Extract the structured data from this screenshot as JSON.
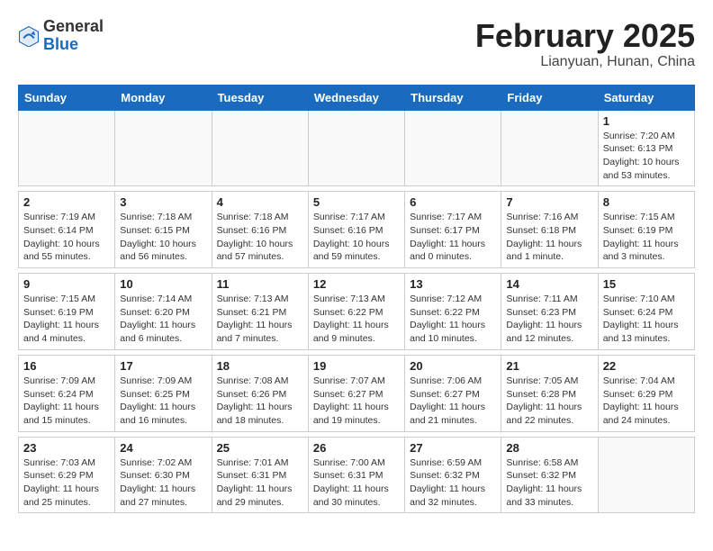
{
  "header": {
    "logo_general": "General",
    "logo_blue": "Blue",
    "month_title": "February 2025",
    "location": "Lianyuan, Hunan, China"
  },
  "days_of_week": [
    "Sunday",
    "Monday",
    "Tuesday",
    "Wednesday",
    "Thursday",
    "Friday",
    "Saturday"
  ],
  "weeks": [
    [
      {
        "day": "",
        "info": ""
      },
      {
        "day": "",
        "info": ""
      },
      {
        "day": "",
        "info": ""
      },
      {
        "day": "",
        "info": ""
      },
      {
        "day": "",
        "info": ""
      },
      {
        "day": "",
        "info": ""
      },
      {
        "day": "1",
        "info": "Sunrise: 7:20 AM\nSunset: 6:13 PM\nDaylight: 10 hours\nand 53 minutes."
      }
    ],
    [
      {
        "day": "2",
        "info": "Sunrise: 7:19 AM\nSunset: 6:14 PM\nDaylight: 10 hours\nand 55 minutes."
      },
      {
        "day": "3",
        "info": "Sunrise: 7:18 AM\nSunset: 6:15 PM\nDaylight: 10 hours\nand 56 minutes."
      },
      {
        "day": "4",
        "info": "Sunrise: 7:18 AM\nSunset: 6:16 PM\nDaylight: 10 hours\nand 57 minutes."
      },
      {
        "day": "5",
        "info": "Sunrise: 7:17 AM\nSunset: 6:16 PM\nDaylight: 10 hours\nand 59 minutes."
      },
      {
        "day": "6",
        "info": "Sunrise: 7:17 AM\nSunset: 6:17 PM\nDaylight: 11 hours\nand 0 minutes."
      },
      {
        "day": "7",
        "info": "Sunrise: 7:16 AM\nSunset: 6:18 PM\nDaylight: 11 hours\nand 1 minute."
      },
      {
        "day": "8",
        "info": "Sunrise: 7:15 AM\nSunset: 6:19 PM\nDaylight: 11 hours\nand 3 minutes."
      }
    ],
    [
      {
        "day": "9",
        "info": "Sunrise: 7:15 AM\nSunset: 6:19 PM\nDaylight: 11 hours\nand 4 minutes."
      },
      {
        "day": "10",
        "info": "Sunrise: 7:14 AM\nSunset: 6:20 PM\nDaylight: 11 hours\nand 6 minutes."
      },
      {
        "day": "11",
        "info": "Sunrise: 7:13 AM\nSunset: 6:21 PM\nDaylight: 11 hours\nand 7 minutes."
      },
      {
        "day": "12",
        "info": "Sunrise: 7:13 AM\nSunset: 6:22 PM\nDaylight: 11 hours\nand 9 minutes."
      },
      {
        "day": "13",
        "info": "Sunrise: 7:12 AM\nSunset: 6:22 PM\nDaylight: 11 hours\nand 10 minutes."
      },
      {
        "day": "14",
        "info": "Sunrise: 7:11 AM\nSunset: 6:23 PM\nDaylight: 11 hours\nand 12 minutes."
      },
      {
        "day": "15",
        "info": "Sunrise: 7:10 AM\nSunset: 6:24 PM\nDaylight: 11 hours\nand 13 minutes."
      }
    ],
    [
      {
        "day": "16",
        "info": "Sunrise: 7:09 AM\nSunset: 6:24 PM\nDaylight: 11 hours\nand 15 minutes."
      },
      {
        "day": "17",
        "info": "Sunrise: 7:09 AM\nSunset: 6:25 PM\nDaylight: 11 hours\nand 16 minutes."
      },
      {
        "day": "18",
        "info": "Sunrise: 7:08 AM\nSunset: 6:26 PM\nDaylight: 11 hours\nand 18 minutes."
      },
      {
        "day": "19",
        "info": "Sunrise: 7:07 AM\nSunset: 6:27 PM\nDaylight: 11 hours\nand 19 minutes."
      },
      {
        "day": "20",
        "info": "Sunrise: 7:06 AM\nSunset: 6:27 PM\nDaylight: 11 hours\nand 21 minutes."
      },
      {
        "day": "21",
        "info": "Sunrise: 7:05 AM\nSunset: 6:28 PM\nDaylight: 11 hours\nand 22 minutes."
      },
      {
        "day": "22",
        "info": "Sunrise: 7:04 AM\nSunset: 6:29 PM\nDaylight: 11 hours\nand 24 minutes."
      }
    ],
    [
      {
        "day": "23",
        "info": "Sunrise: 7:03 AM\nSunset: 6:29 PM\nDaylight: 11 hours\nand 25 minutes."
      },
      {
        "day": "24",
        "info": "Sunrise: 7:02 AM\nSunset: 6:30 PM\nDaylight: 11 hours\nand 27 minutes."
      },
      {
        "day": "25",
        "info": "Sunrise: 7:01 AM\nSunset: 6:31 PM\nDaylight: 11 hours\nand 29 minutes."
      },
      {
        "day": "26",
        "info": "Sunrise: 7:00 AM\nSunset: 6:31 PM\nDaylight: 11 hours\nand 30 minutes."
      },
      {
        "day": "27",
        "info": "Sunrise: 6:59 AM\nSunset: 6:32 PM\nDaylight: 11 hours\nand 32 minutes."
      },
      {
        "day": "28",
        "info": "Sunrise: 6:58 AM\nSunset: 6:32 PM\nDaylight: 11 hours\nand 33 minutes."
      },
      {
        "day": "",
        "info": ""
      }
    ]
  ]
}
